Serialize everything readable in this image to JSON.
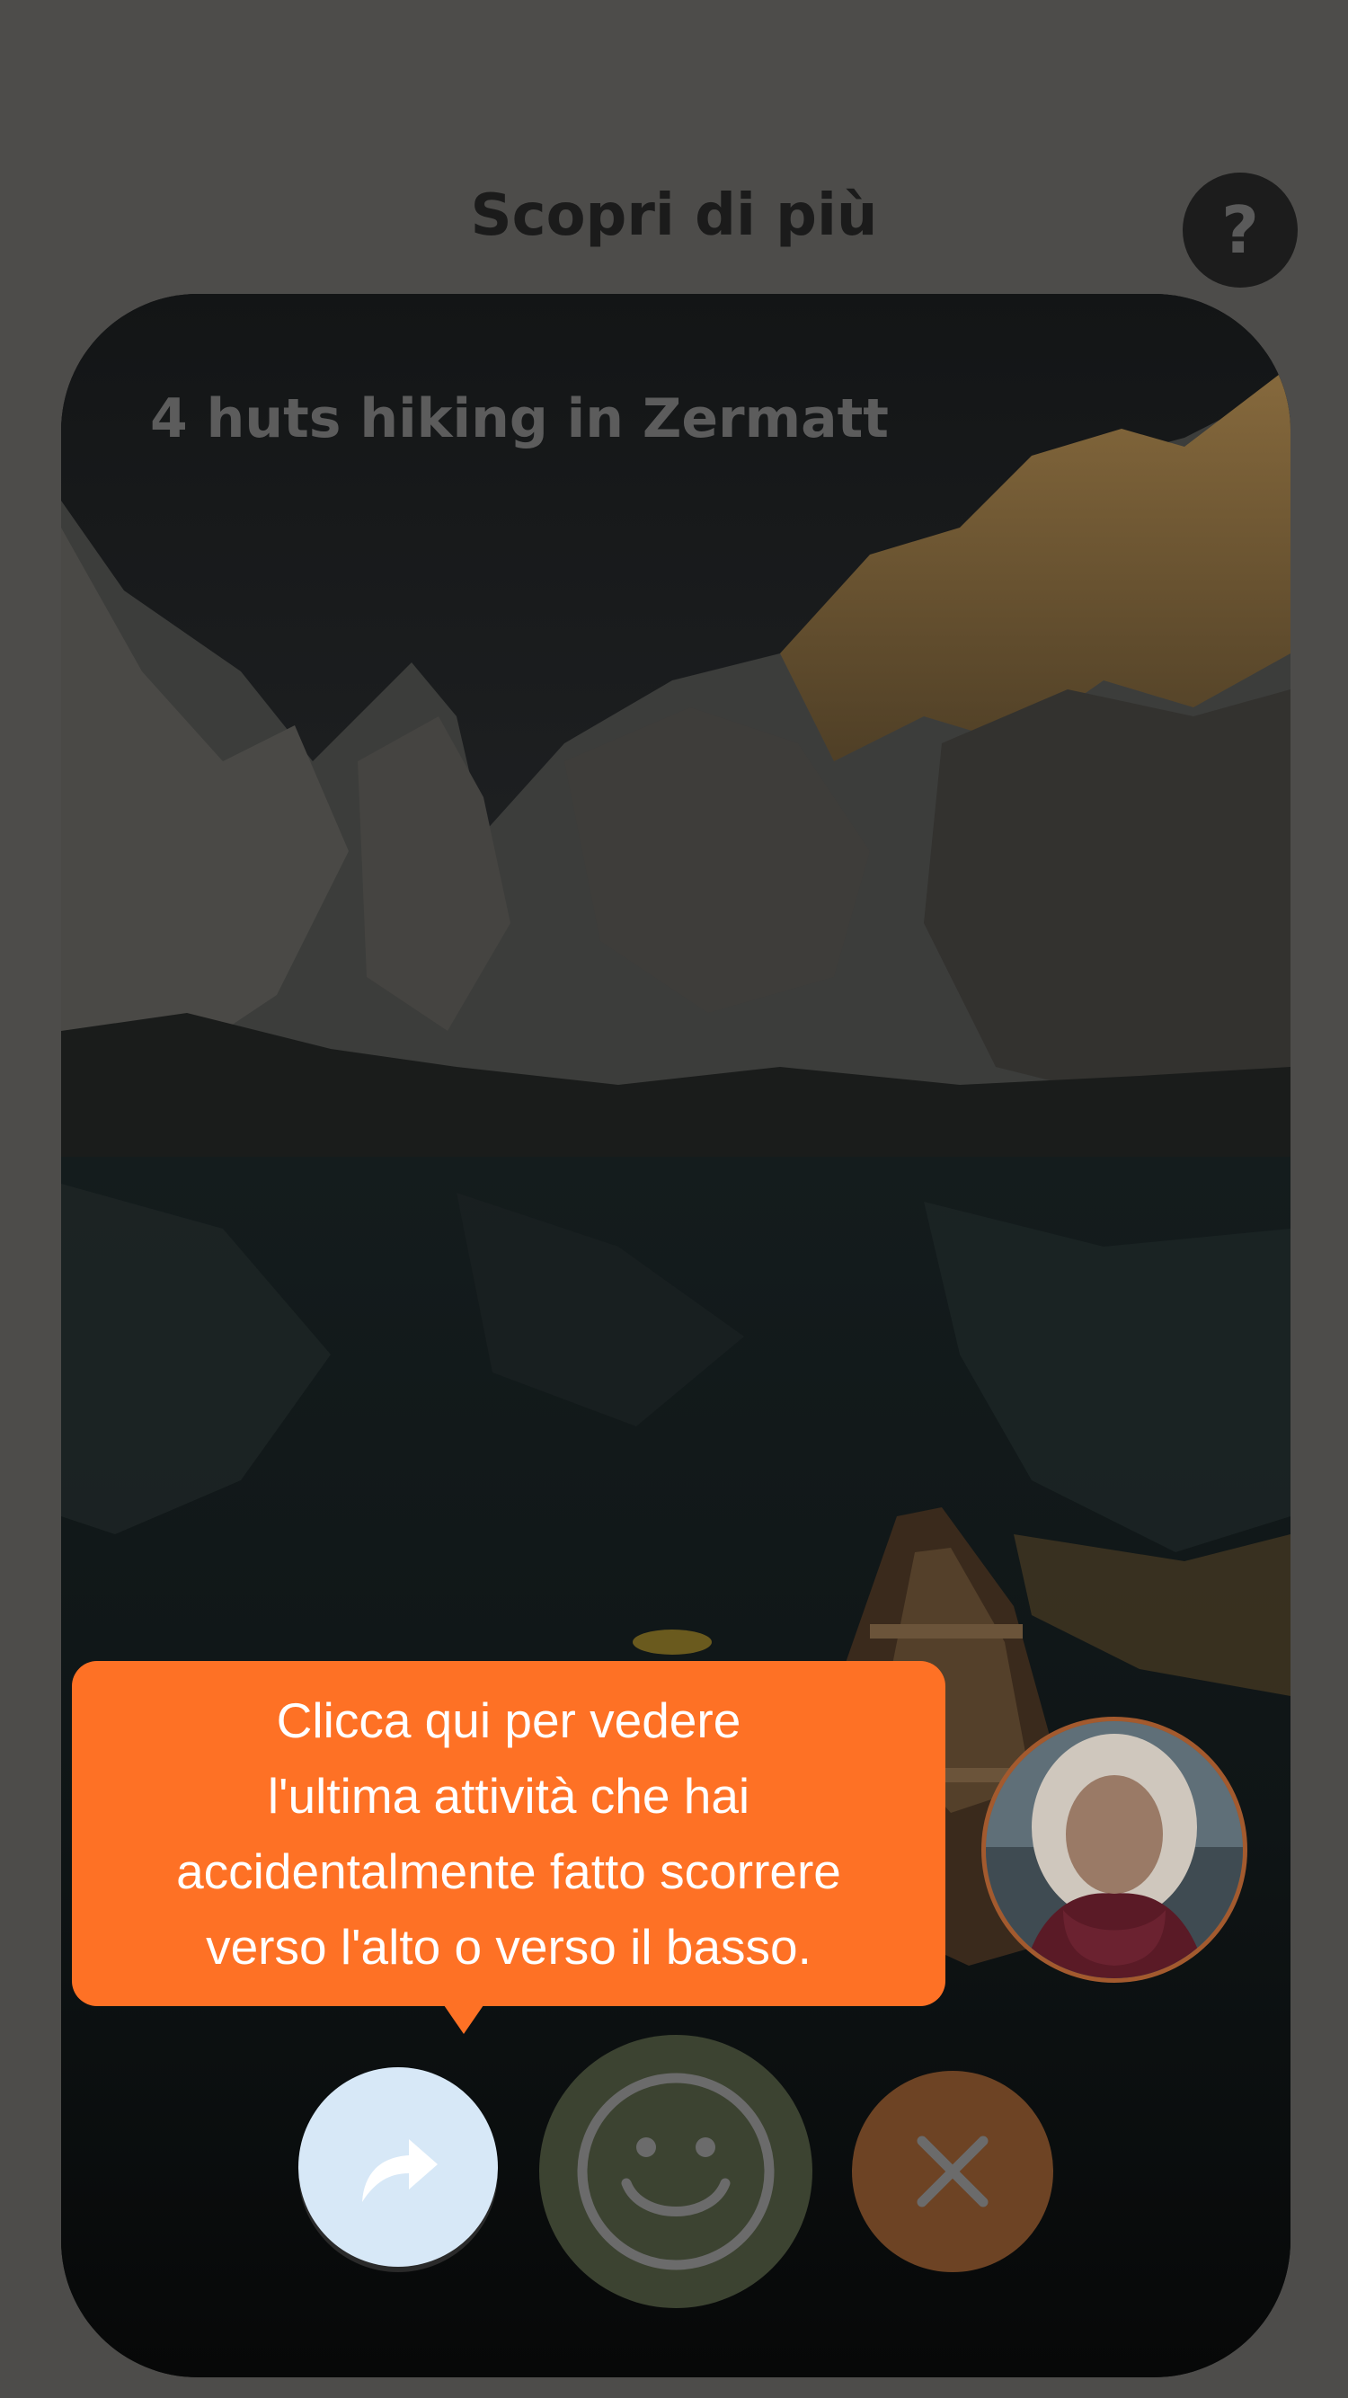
{
  "header": {
    "title": "Scopri di più",
    "help_icon": "question-mark-icon",
    "help_label": "?"
  },
  "card": {
    "title": "4 huts hiking in Zermatt",
    "photo": "mountain-lake-with-rowboat-photo",
    "host_avatar": "host-avatar-photo"
  },
  "tooltip": {
    "lines": [
      "Clicca qui per vedere",
      "l'ultima attività che hai",
      "accidentalmente fatto scorrere",
      "verso l'alto o verso il basso."
    ]
  },
  "actions": {
    "undo_icon": "undo-arrow-icon",
    "like_icon": "smiley-face-icon",
    "dismiss_icon": "close-x-icon"
  },
  "colors": {
    "overlay_background": "#4d4c4a",
    "tooltip_orange": "#fe7125",
    "undo_button": "#d7e8f7",
    "like_button": "#3c4331",
    "dismiss_button": "#6d4324",
    "icon_gray": "#6b6b6b"
  }
}
